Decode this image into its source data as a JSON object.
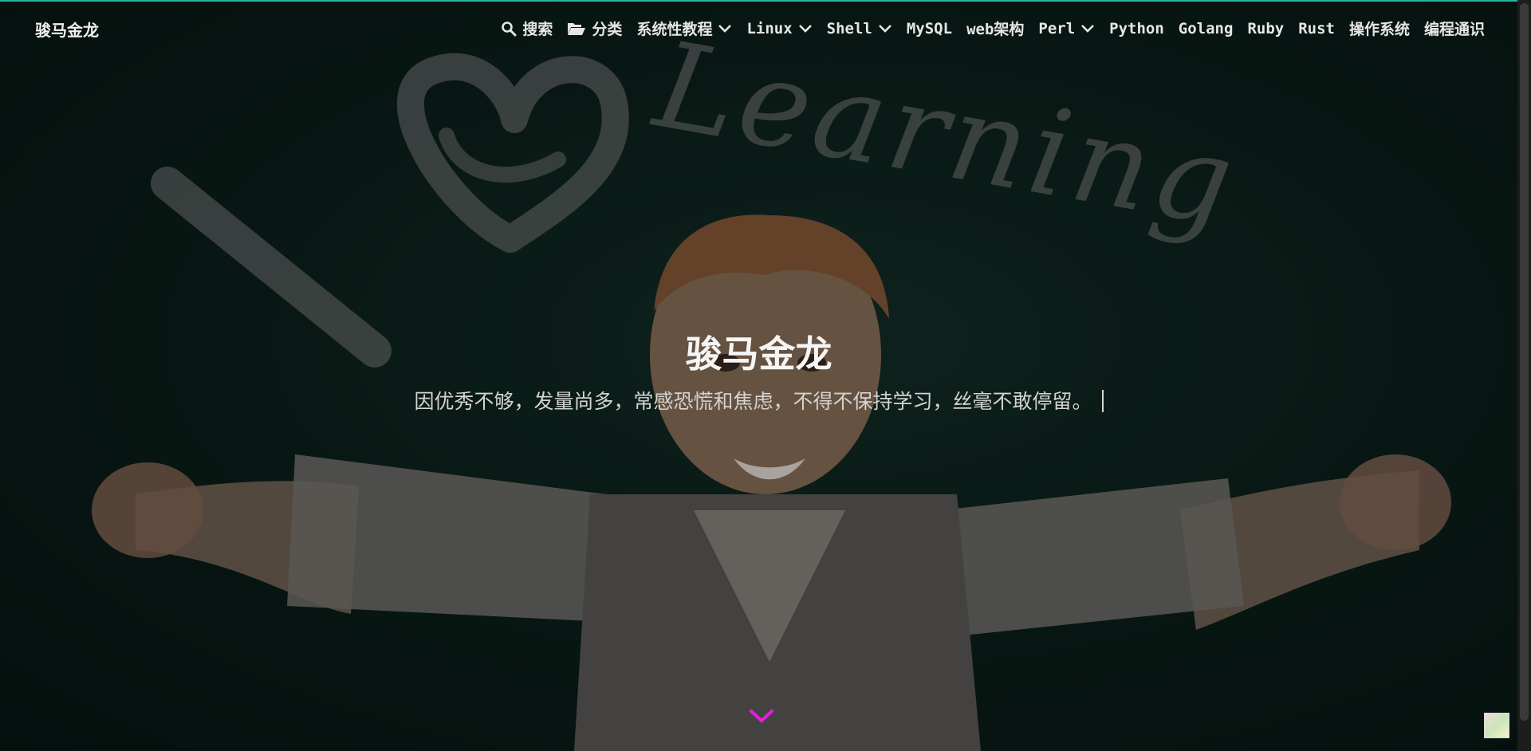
{
  "brand": {
    "name": "骏马金龙"
  },
  "nav": {
    "items": [
      {
        "label": "搜索",
        "icon": "search-icon",
        "dropdown": false
      },
      {
        "label": "分类",
        "icon": "folder-open-icon",
        "dropdown": false
      },
      {
        "label": "系统性教程",
        "dropdown": true
      },
      {
        "label": "Linux",
        "dropdown": true
      },
      {
        "label": "Shell",
        "dropdown": true
      },
      {
        "label": "MySQL",
        "dropdown": false
      },
      {
        "label": "web架构",
        "dropdown": false
      },
      {
        "label": "Perl",
        "dropdown": true
      },
      {
        "label": "Python",
        "dropdown": false
      },
      {
        "label": "Golang",
        "dropdown": false
      },
      {
        "label": "Ruby",
        "dropdown": false
      },
      {
        "label": "Rust",
        "dropdown": false
      },
      {
        "label": "操作系统",
        "dropdown": false
      },
      {
        "label": "编程通识",
        "dropdown": false
      }
    ]
  },
  "hero": {
    "title": "骏马金龙",
    "subtitle": "因优秀不够，发量尚多，常感恐慌和焦虑，不得不保持学习，丝毫不敢停留。",
    "background_chalk_text": "Learning"
  },
  "colors": {
    "accent_top_line": "#2bb5a0",
    "scroll_arrow": "#e020e0",
    "chalkboard": "#0d221d"
  }
}
